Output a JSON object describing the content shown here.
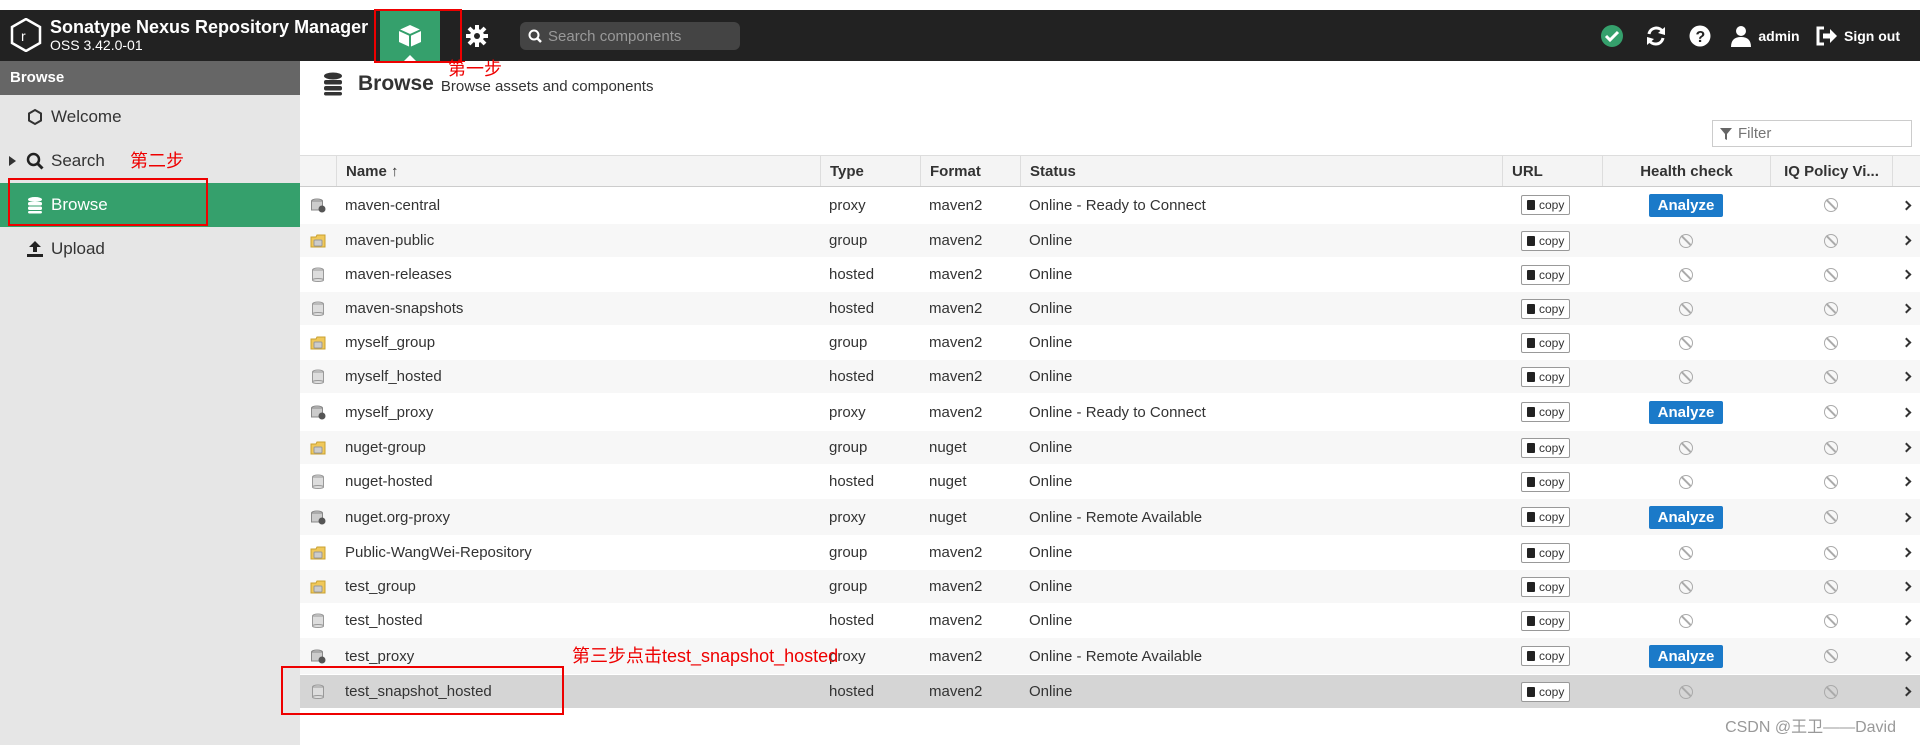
{
  "header": {
    "product_name": "Sonatype Nexus Repository Manager",
    "version": "OSS 3.42.0-01",
    "search_placeholder": "Search components",
    "user": "admin",
    "sign_out": "Sign out"
  },
  "sidebar": {
    "title": "Browse",
    "items": [
      {
        "label": "Welcome",
        "icon": "hexagon-icon"
      },
      {
        "label": "Search",
        "icon": "search-icon"
      },
      {
        "label": "Browse",
        "icon": "database-icon"
      },
      {
        "label": "Upload",
        "icon": "upload-icon"
      }
    ]
  },
  "main": {
    "title": "Browse",
    "subtitle": "Browse assets and components",
    "filter_placeholder": "Filter"
  },
  "grid": {
    "columns": {
      "name": "Name ↑",
      "type": "Type",
      "format": "Format",
      "status": "Status",
      "url": "URL",
      "health": "Health check",
      "iq": "IQ Policy Vi..."
    },
    "copy_label": "copy",
    "analyze_label": "Analyze",
    "rows": [
      {
        "name": "maven-central",
        "type": "proxy",
        "format": "maven2",
        "status": "Online - Ready to Connect"
      },
      {
        "name": "maven-public",
        "type": "group",
        "format": "maven2",
        "status": "Online"
      },
      {
        "name": "maven-releases",
        "type": "hosted",
        "format": "maven2",
        "status": "Online"
      },
      {
        "name": "maven-snapshots",
        "type": "hosted",
        "format": "maven2",
        "status": "Online"
      },
      {
        "name": "myself_group",
        "type": "group",
        "format": "maven2",
        "status": "Online"
      },
      {
        "name": "myself_hosted",
        "type": "hosted",
        "format": "maven2",
        "status": "Online"
      },
      {
        "name": "myself_proxy",
        "type": "proxy",
        "format": "maven2",
        "status": "Online - Ready to Connect"
      },
      {
        "name": "nuget-group",
        "type": "group",
        "format": "nuget",
        "status": "Online"
      },
      {
        "name": "nuget-hosted",
        "type": "hosted",
        "format": "nuget",
        "status": "Online"
      },
      {
        "name": "nuget.org-proxy",
        "type": "proxy",
        "format": "nuget",
        "status": "Online - Remote Available"
      },
      {
        "name": "Public-WangWei-Repository",
        "type": "group",
        "format": "maven2",
        "status": "Online"
      },
      {
        "name": "test_group",
        "type": "group",
        "format": "maven2",
        "status": "Online"
      },
      {
        "name": "test_hosted",
        "type": "hosted",
        "format": "maven2",
        "status": "Online"
      },
      {
        "name": "test_proxy",
        "type": "proxy",
        "format": "maven2",
        "status": "Online - Remote Available"
      },
      {
        "name": "test_snapshot_hosted",
        "type": "hosted",
        "format": "maven2",
        "status": "Online"
      }
    ]
  },
  "annotations": {
    "step1": "第一步",
    "step2": "第二步",
    "step3": "第三步点击test_snapshot_hosted"
  },
  "watermark": "CSDN @王卫——David",
  "colors": {
    "accent": "#35a06c",
    "analyze": "#1b7ac9",
    "annotation": "#e00000"
  }
}
